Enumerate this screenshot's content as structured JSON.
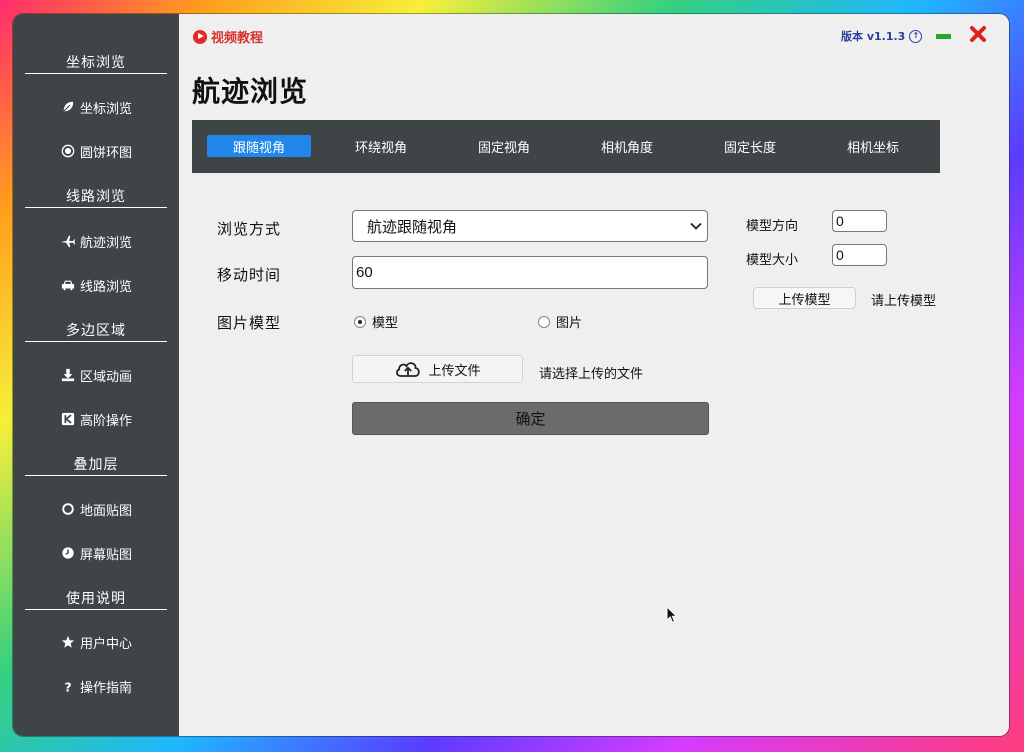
{
  "sidebar": {
    "sections": [
      {
        "title": "坐标浏览",
        "items": [
          {
            "label": "坐标浏览",
            "icon": "leaf-icon"
          },
          {
            "label": "圆饼环图",
            "icon": "target-icon"
          }
        ]
      },
      {
        "title": "线路浏览",
        "items": [
          {
            "label": "航迹浏览",
            "icon": "plane-icon"
          },
          {
            "label": "线路浏览",
            "icon": "car-icon"
          }
        ]
      },
      {
        "title": "多边区域",
        "items": [
          {
            "label": "区域动画",
            "icon": "download-icon"
          },
          {
            "label": "高阶操作",
            "icon": "k-box-icon"
          }
        ]
      },
      {
        "title": "叠加层",
        "items": [
          {
            "label": "地面贴图",
            "icon": "circle-icon"
          },
          {
            "label": "屏幕贴图",
            "icon": "clock-icon"
          }
        ]
      },
      {
        "title": "使用说明",
        "items": [
          {
            "label": "用户中心",
            "icon": "star-icon"
          },
          {
            "label": "操作指南",
            "icon": "question-icon"
          }
        ]
      }
    ]
  },
  "header": {
    "video_link": "视频教程",
    "version": "版本 v1.1.3",
    "page_title": "航迹浏览"
  },
  "tabs": [
    "跟随视角",
    "环绕视角",
    "固定视角",
    "相机角度",
    "固定长度",
    "相机坐标"
  ],
  "active_tab": 0,
  "form": {
    "browse_mode_label": "浏览方式",
    "browse_mode_value": "航迹跟随视角",
    "move_time_label": "移动时间",
    "move_time_value": "60",
    "image_model_label": "图片模型",
    "radio_model": "模型",
    "radio_image": "图片",
    "radio_selected": "模型",
    "upload_file_button": "上传文件",
    "upload_file_hint": "请选择上传的文件",
    "confirm_button": "确定"
  },
  "model_panel": {
    "direction_label": "模型方向",
    "direction_value": "0",
    "size_label": "模型大小",
    "size_value": "0",
    "upload_model_button": "上传模型",
    "upload_model_hint": "请上传模型"
  },
  "colors": {
    "sidebar_bg": "#3f4447",
    "active_tab": "#2187ea",
    "video_red": "#e3262a",
    "version_blue": "#2b3f9e",
    "minimize_green": "#2aa52c",
    "close_red": "#e01f1f"
  }
}
